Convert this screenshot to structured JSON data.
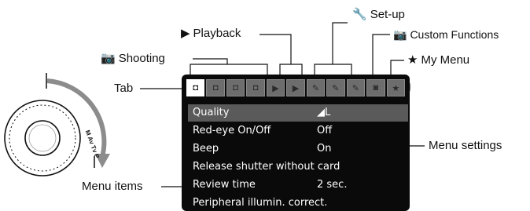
{
  "labels": {
    "setup": {
      "icon": "🔧",
      "text": "Set-up"
    },
    "playback": {
      "icon": "▶",
      "text": "Playback"
    },
    "custom": {
      "icon": "📷",
      "text": "Custom Functions"
    },
    "shooting": {
      "icon": "📷",
      "text": "Shooting"
    },
    "mymenu": {
      "icon": "★",
      "text": "My Menu"
    },
    "tab": "Tab",
    "menu_settings": "Menu settings",
    "menu_items": "Menu items"
  },
  "tabs": [
    {
      "name": "shooting-1",
      "icon": "camera-icon",
      "glyph": "◘",
      "active": true
    },
    {
      "name": "shooting-2",
      "icon": "camera-icon",
      "glyph": "◘",
      "active": false
    },
    {
      "name": "shooting-3",
      "icon": "camera-icon",
      "glyph": "◘",
      "active": false
    },
    {
      "name": "shooting-4",
      "icon": "camera-icon",
      "glyph": "◘",
      "active": false
    },
    {
      "name": "playback-1",
      "icon": "playback-icon",
      "glyph": "▶",
      "active": false
    },
    {
      "name": "playback-2",
      "icon": "playback-icon",
      "glyph": "▶",
      "active": false
    },
    {
      "name": "setup-1",
      "icon": "wrench-icon",
      "glyph": "✎",
      "active": false
    },
    {
      "name": "setup-2",
      "icon": "wrench-icon",
      "glyph": "✎",
      "active": false
    },
    {
      "name": "setup-3",
      "icon": "wrench-icon",
      "glyph": "✎",
      "active": false
    },
    {
      "name": "custom-functions",
      "icon": "custom-camera-icon",
      "glyph": "◙",
      "active": false
    },
    {
      "name": "my-menu",
      "icon": "star-icon",
      "glyph": "★",
      "active": false
    }
  ],
  "menu": {
    "rows": [
      {
        "item": "Quality",
        "value": "◢L"
      },
      {
        "item": "Red-eye On/Off",
        "value": "Off"
      },
      {
        "item": "Beep",
        "value": "On"
      },
      {
        "item": "Release shutter without card",
        "value": ""
      },
      {
        "item": "Review time",
        "value": "2 sec."
      },
      {
        "item": "Peripheral illumin. correct.",
        "value": ""
      }
    ]
  },
  "dial": {
    "marks": "M Av Tv P"
  }
}
